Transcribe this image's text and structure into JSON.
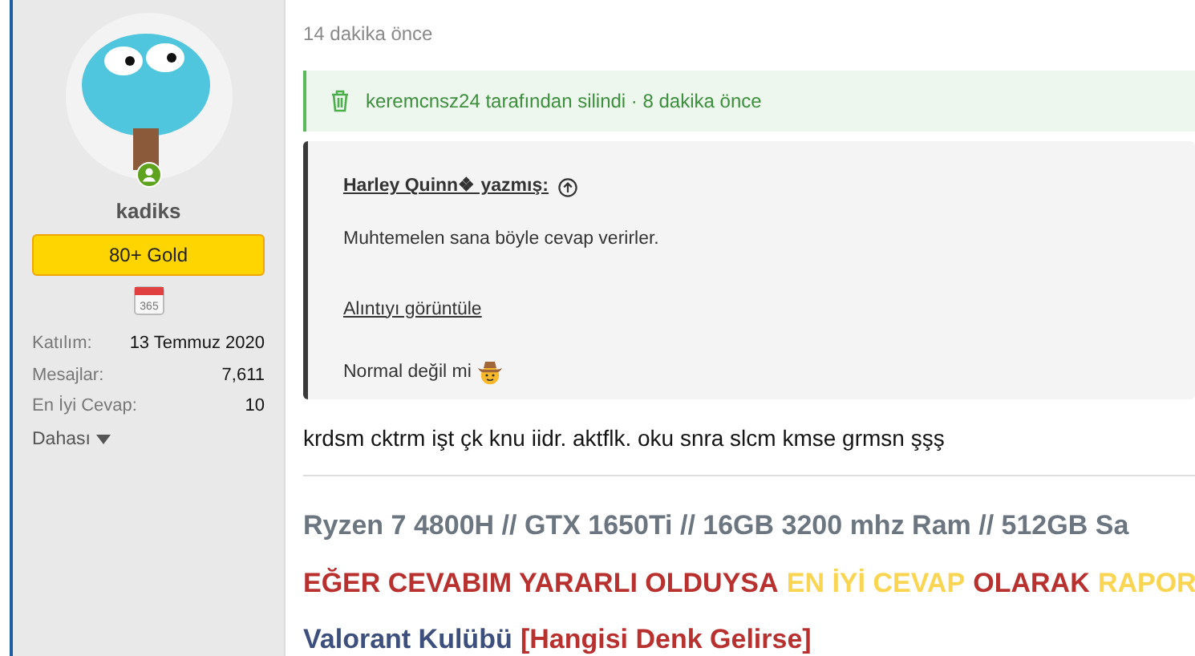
{
  "user": {
    "name": "kadiks",
    "online": true,
    "badge": "80+ Gold",
    "calendar_label": "365",
    "stats": [
      {
        "label": "Katılım:",
        "value": "13 Temmuz 2020"
      },
      {
        "label": "Mesajlar:",
        "value": "7,611"
      },
      {
        "label": "En İyi Cevap:",
        "value": "10"
      }
    ],
    "more": "Dahası"
  },
  "post": {
    "time": "14 dakika önce",
    "deleted_notice": "keremcnsz24 tarafından silindi · 8 dakika önce",
    "quote": {
      "author": "Harley Quinn❖ yazmış:",
      "text": "Muhtemelen sana böyle cevap verirler.",
      "expand": "Alıntıyı görüntüle",
      "reply": "Normal değil mi"
    },
    "body": "krdsm cktrm işt çk knu iidr. aktflk. oku snra slcm kmse grmsn şşş",
    "signature": [
      [
        {
          "text": "Ryzen 7 4800H // GTX 1650Ti // 16GB 3200 mhz Ram // 512GB Sa",
          "color": "#6c7680"
        }
      ],
      [
        {
          "text": "EĞER CEVABIM YARARLI OLDUYSA",
          "color": "#b8312f"
        },
        {
          "text": "EN İYİ CEVAP",
          "color": "#fad552"
        },
        {
          "text": "OLARAK",
          "color": "#b8312f"
        },
        {
          "text": "RAPOR",
          "color": "#fad552"
        }
      ],
      [
        {
          "text": "Valorant Kulübü",
          "color": "#3d4f7c"
        },
        {
          "text": "[Hangisi Denk Gelirse]",
          "color": "#b8312f"
        }
      ]
    ]
  }
}
